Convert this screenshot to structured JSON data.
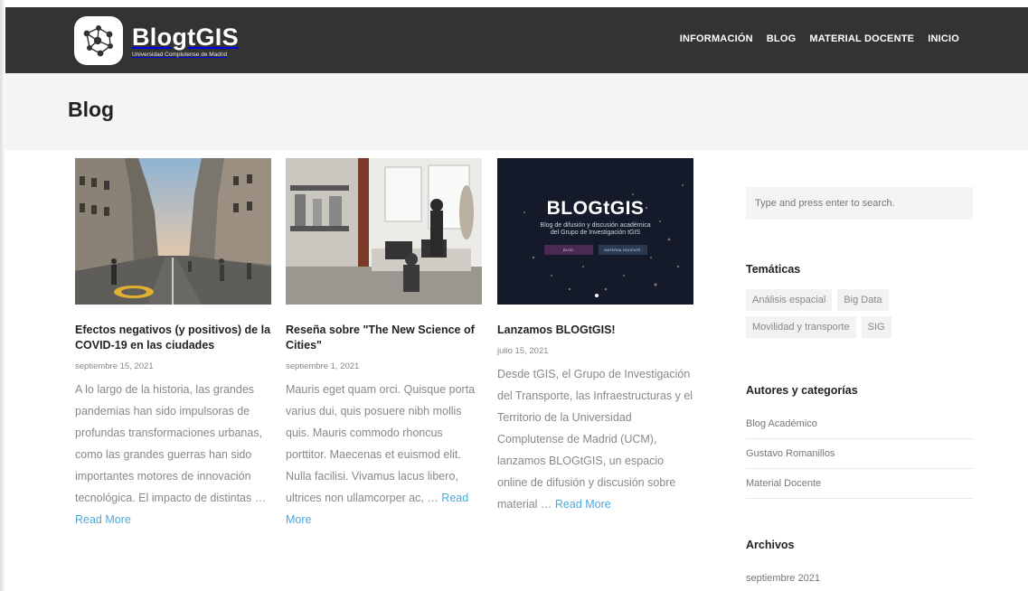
{
  "header": {
    "site_name": "BlogtGIS",
    "site_subtitle": "Universidad Complutense de Madrid",
    "nav": [
      "INFORMACIÓN",
      "BLOG",
      "MATERIAL DOCENTE",
      "INICIO"
    ]
  },
  "page": {
    "title": "Blog"
  },
  "posts": [
    {
      "title": "Efectos negativos (y positivos) de la COVID-19 en las ciudades",
      "date": "septiembre 15, 2021",
      "excerpt": "A lo largo de la historia, las grandes pandemias han sido impulsoras de profundas transformaciones urbanas, como las grandes guerras han sido importantes motores de innovación tecnológica. El impacto de distintas … ",
      "read_more": "Read More"
    },
    {
      "title": "Reseña sobre \"The New Science of Cities\"",
      "date": "septiembre 1, 2021",
      "excerpt": "Mauris eget quam orci. Quisque porta varius dui, quis posuere nibh mollis quis. Mauris commodo rhoncus porttitor. Maecenas et euismod elit. Nulla facilisi. Vivamus lacus libero, ultrices non ullamcorper ac, … ",
      "read_more": "Read More"
    },
    {
      "title": "Lanzamos BLOGtGIS!",
      "date": "julio 15, 2021",
      "excerpt": "Desde tGIS, el Grupo de Investigación del Transporte, las Infraestructuras y el Territorio de la Universidad Complutense de Madrid (UCM), lanzamos BLOGtGIS, un espacio online de difusión y discusión sobre material … ",
      "read_more": "Read More"
    }
  ],
  "banner": {
    "title": "BLOGtGIS",
    "line1": "Blog de difusión y discusión académica",
    "line2": "del Grupo de Investigación tGIS",
    "btn1": "BLOG",
    "btn2": "MATERIAL DOCENTE"
  },
  "sidebar": {
    "search_placeholder": "Type and press enter to search.",
    "tematicas_title": "Temáticas",
    "tags": [
      "Análisis espacial",
      "Big Data",
      "Movilidad y transporte",
      "SIG"
    ],
    "autores_title": "Autores y categorías",
    "authors": [
      "Blog Académico",
      "Gustavo Romanillos",
      "Material Docente"
    ],
    "archivos_title": "Archivos",
    "archives": [
      "septiembre 2021"
    ]
  },
  "colors": {
    "header_bg": "#333333",
    "title_band_bg": "#f4f4f4",
    "link_accent": "#4ea9d8"
  }
}
